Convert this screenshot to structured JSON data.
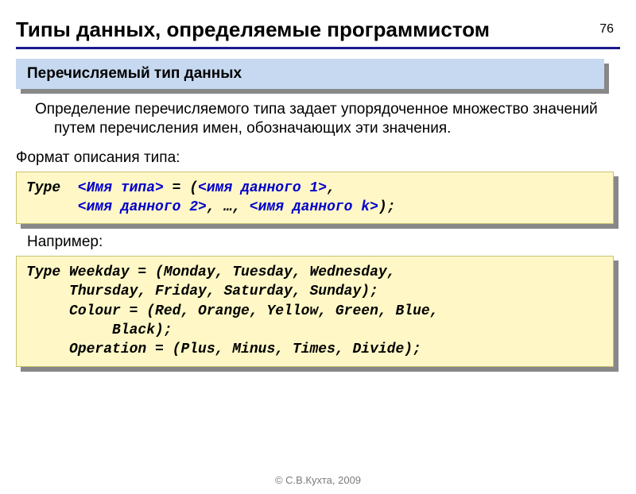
{
  "page_number": "76",
  "title": "Типы данных, определяемые программистом",
  "subtitle": "Перечисляемый тип данных",
  "body": "Определение перечисляемого типа задает упорядоченное множество значений путем перечисления имен, обозначающих эти значения.",
  "format_label": "Формат описания типа:",
  "code1": {
    "kw": "Type  ",
    "m1": "<Имя типа>",
    "t1": " = (",
    "m2": "<имя данного 1>",
    "t2": ",\n      ",
    "m3": "<имя данного 2>",
    "t3": ", …, ",
    "m4": "<имя данного k>",
    "t4": ");"
  },
  "example_label": "Например:",
  "code2": "Type Weekday = (Monday, Tuesday, Wednesday,\n     Thursday, Friday, Saturday, Sunday);\n     Colour = (Red, Orange, Yellow, Green, Blue,\n          Black);\n     Operation = (Plus, Minus, Times, Divide);",
  "footer": "© С.В.Кухта, 2009"
}
